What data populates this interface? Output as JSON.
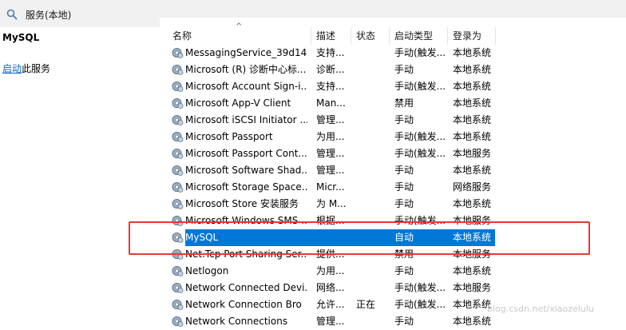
{
  "window": {
    "title": "服务(本地)"
  },
  "left_pane": {
    "service_name": "MySQL",
    "action_link": "启动",
    "action_suffix": "此服务"
  },
  "columns": {
    "name": "名称",
    "description": "描述",
    "status": "状态",
    "startup_type": "启动类型",
    "log_on_as": "登录为"
  },
  "services": [
    {
      "name": "MessagingService_39d14",
      "description": "支持...",
      "status": "",
      "startup_type": "手动(触发...",
      "log_on_as": "本地系统",
      "selected": false
    },
    {
      "name": "Microsoft (R) 诊断中心标...",
      "description": "诊断...",
      "status": "",
      "startup_type": "手动",
      "log_on_as": "本地系统",
      "selected": false
    },
    {
      "name": "Microsoft Account Sign-i...",
      "description": "支持...",
      "status": "",
      "startup_type": "手动(触发...",
      "log_on_as": "本地系统",
      "selected": false
    },
    {
      "name": "Microsoft App-V Client",
      "description": "Man...",
      "status": "",
      "startup_type": "禁用",
      "log_on_as": "本地系统",
      "selected": false
    },
    {
      "name": "Microsoft iSCSI Initiator ...",
      "description": "管理...",
      "status": "",
      "startup_type": "手动",
      "log_on_as": "本地系统",
      "selected": false
    },
    {
      "name": "Microsoft Passport",
      "description": "为用...",
      "status": "",
      "startup_type": "手动(触发...",
      "log_on_as": "本地系统",
      "selected": false
    },
    {
      "name": "Microsoft Passport Cont...",
      "description": "管理...",
      "status": "",
      "startup_type": "手动(触发...",
      "log_on_as": "本地服务",
      "selected": false
    },
    {
      "name": "Microsoft Software Shad...",
      "description": "管理...",
      "status": "",
      "startup_type": "手动",
      "log_on_as": "本地系统",
      "selected": false
    },
    {
      "name": "Microsoft Storage Space...",
      "description": "Micr...",
      "status": "",
      "startup_type": "手动",
      "log_on_as": "网络服务",
      "selected": false
    },
    {
      "name": "Microsoft Store 安装服务",
      "description": "为 M...",
      "status": "",
      "startup_type": "手动",
      "log_on_as": "本地系统",
      "selected": false
    },
    {
      "name": "Microsoft Windows SMS ...",
      "description": "根据...",
      "status": "",
      "startup_type": "手动(触发...",
      "log_on_as": "本地服务",
      "selected": false
    },
    {
      "name": "MySQL",
      "description": "",
      "status": "",
      "startup_type": "自动",
      "log_on_as": "本地系统",
      "selected": true
    },
    {
      "name": "Net.Tcp Port Sharing Ser...",
      "description": "提供...",
      "status": "",
      "startup_type": "禁用",
      "log_on_as": "本地服务",
      "selected": false
    },
    {
      "name": "Netlogon",
      "description": "为用...",
      "status": "",
      "startup_type": "手动",
      "log_on_as": "本地系统",
      "selected": false
    },
    {
      "name": "Network Connected Devi...",
      "description": "网络...",
      "status": "",
      "startup_type": "手动(触发...",
      "log_on_as": "本地服务",
      "selected": false
    },
    {
      "name": "Network Connection Bro",
      "description": "允许...",
      "status": "正在",
      "startup_type": "手动(触发...",
      "log_on_as": "本地系统",
      "selected": false
    },
    {
      "name": "Network Connections",
      "description": "管理...",
      "status": "",
      "startup_type": "手动",
      "log_on_as": "本地系统",
      "selected": false
    }
  ],
  "watermark": "blog.csdn.net/xiaozelulu",
  "colors": {
    "selection": "#0078d7",
    "highlight_box": "#e53935",
    "link": "#0066cc"
  }
}
